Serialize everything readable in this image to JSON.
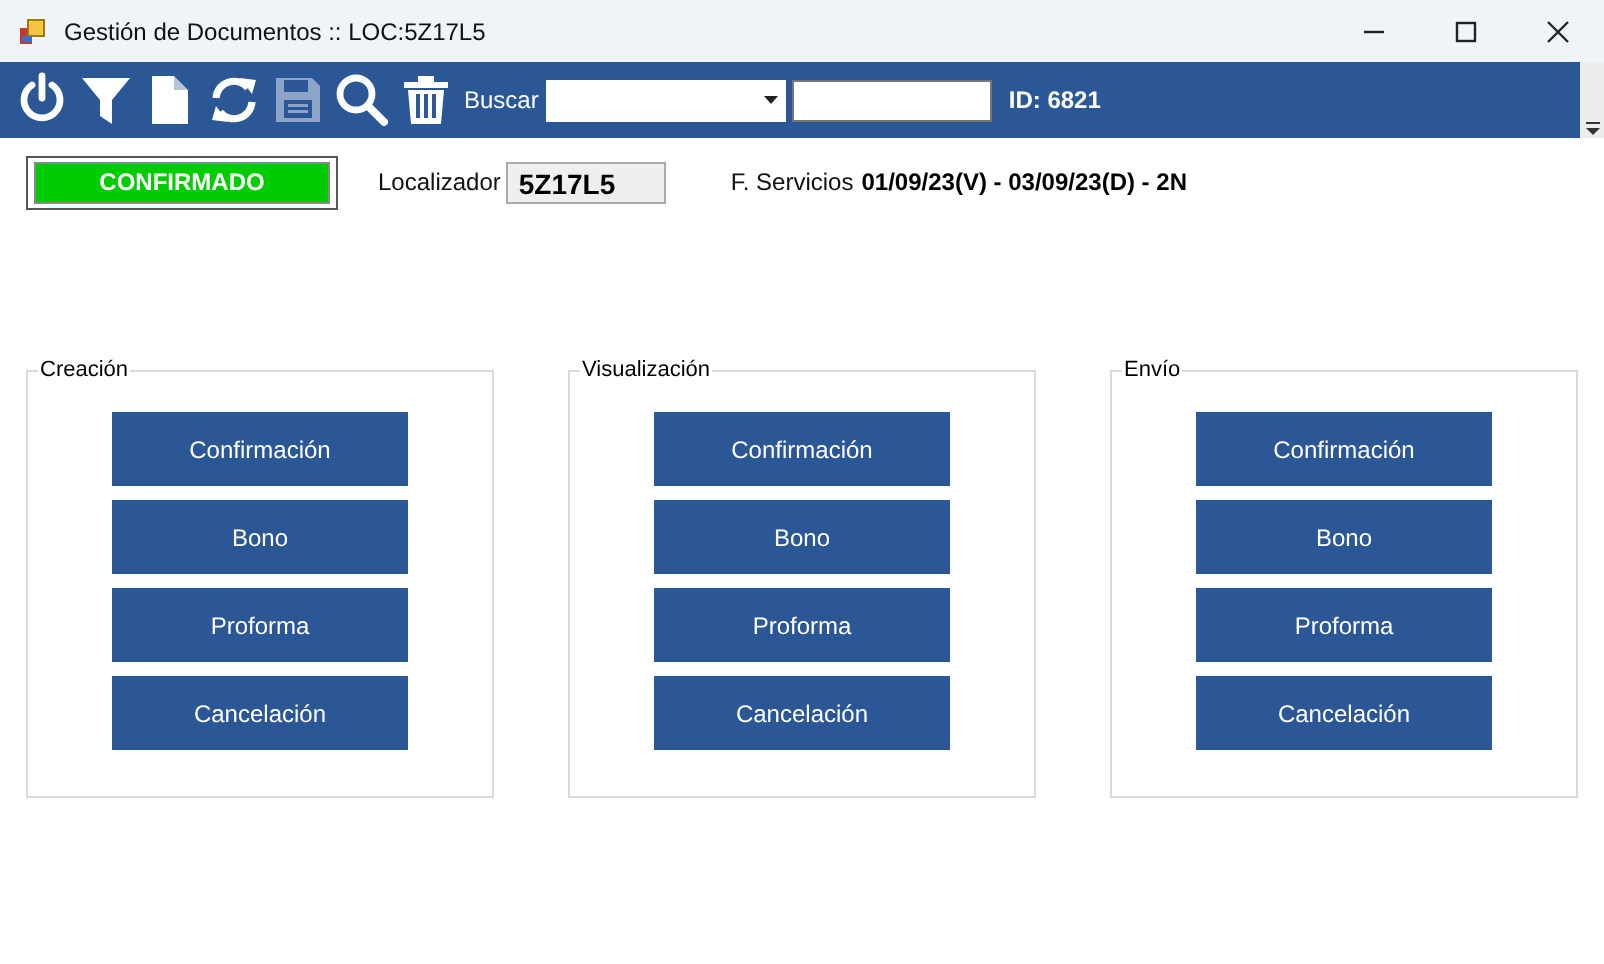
{
  "window": {
    "title": "Gestión de Documentos :: LOC:5Z17L5"
  },
  "toolbar": {
    "tools": [
      {
        "kind": "power",
        "disabled": false
      },
      {
        "kind": "filter",
        "disabled": false
      },
      {
        "kind": "file",
        "disabled": false
      },
      {
        "kind": "refresh",
        "disabled": false
      },
      {
        "kind": "save",
        "disabled": true
      },
      {
        "kind": "search",
        "disabled": false
      },
      {
        "kind": "trash",
        "disabled": false
      }
    ],
    "search_label": "Buscar",
    "id_label": "ID: 6821"
  },
  "status": "CONFIRMADO",
  "locator": {
    "label": "Localizador",
    "value": "5Z17L5"
  },
  "services": {
    "label": "F. Servicios",
    "value": "01/09/23(V) - 03/09/23(D) - 2N"
  },
  "groups": [
    {
      "title": "Creación",
      "buttons": [
        "Confirmación",
        "Bono",
        "Proforma",
        "Cancelación"
      ]
    },
    {
      "title": "Visualización",
      "buttons": [
        "Confirmación",
        "Bono",
        "Proforma",
        "Cancelación"
      ]
    },
    {
      "title": "Envío",
      "buttons": [
        "Confirmación",
        "Bono",
        "Proforma",
        "Cancelación"
      ]
    }
  ]
}
